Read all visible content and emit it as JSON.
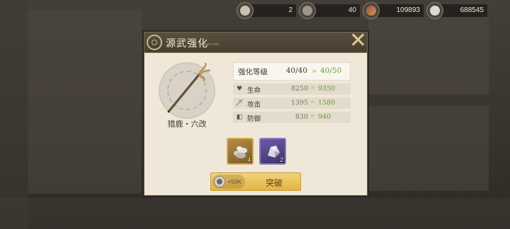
{
  "resources": [
    {
      "icon": "silver-ore-icon",
      "value": "2"
    },
    {
      "icon": "stone-ore-icon",
      "value": "40"
    },
    {
      "icon": "feather-icon",
      "value": "109893"
    },
    {
      "icon": "silver-coin-icon",
      "value": "688545"
    }
  ],
  "dialog": {
    "title": "源武强化",
    "subtitle": "UPGRADE"
  },
  "weapon": {
    "name": "猎鹿・六改",
    "icon": "staff-weapon-icon"
  },
  "level": {
    "label": "强化等级",
    "from": "40/40",
    "to": "40/50"
  },
  "stats": [
    {
      "icon": "heart-icon",
      "label": "生命",
      "from": "8250",
      "to": "9350"
    },
    {
      "icon": "sword-icon",
      "label": "攻击",
      "from": "1395",
      "to": "1580"
    },
    {
      "icon": "shield-icon",
      "label": "防御",
      "from": "830",
      "to": "940"
    }
  ],
  "materials": [
    {
      "icon": "silver-ore-pile-icon",
      "count": "4"
    },
    {
      "icon": "crystal-stone-icon",
      "count": "2"
    }
  ],
  "breakthrough": {
    "cost": "×50K",
    "label": "突破"
  },
  "colors": {
    "increase": "#6c9d31",
    "accent": "#e1b55a",
    "button": "#f0c95f"
  }
}
